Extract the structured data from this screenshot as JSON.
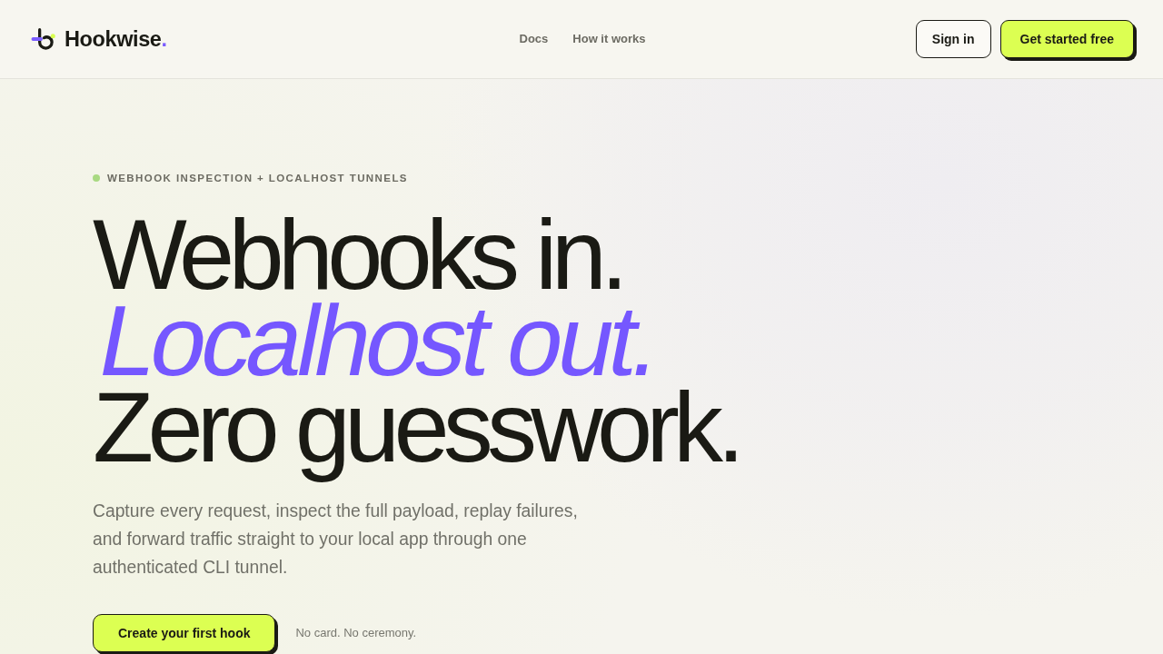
{
  "nav": {
    "brand": {
      "name": "Hookwise",
      "accent": "."
    },
    "links": [
      "Docs",
      "How it works"
    ],
    "actions": [
      {
        "label": "Sign in",
        "kind": "secondary"
      },
      {
        "label": "Get started free",
        "kind": "primary"
      }
    ]
  },
  "hero": {
    "eyebrow": "WEBHOOK INSPECTION + LOCALHOST TUNNELS",
    "headline": [
      {
        "text": "Webhooks in.",
        "kind": "plain"
      },
      {
        "text": "Localhost out.",
        "kind": "accent"
      },
      {
        "text": "Zero guesswork.",
        "kind": "plain"
      }
    ],
    "description": "Capture every request, inspect the full payload, replay failures, and forward traffic straight to your local app through one authenticated CLI tunnel.",
    "cta": {
      "label": "Create your first hook"
    },
    "note": "No card. No ceremony."
  }
}
